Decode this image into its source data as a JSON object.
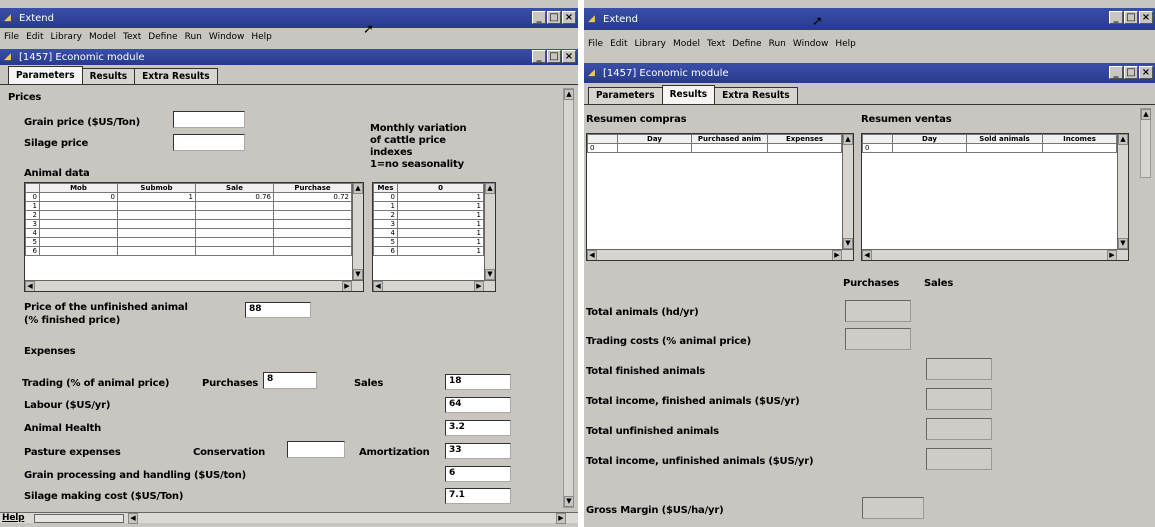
{
  "left": {
    "app_title": "Extend",
    "menu": [
      "File",
      "Edit",
      "Library",
      "Model",
      "Text",
      "Define",
      "Run",
      "Window",
      "Help"
    ],
    "doc_title": "[1457]  Economic module",
    "tabs": [
      "Parameters",
      "Results",
      "Extra Results"
    ],
    "prices_heading": "Prices",
    "grain_price_label": "Grain price ($US/Ton)",
    "silage_price_label": "Silage price",
    "monthly_variation_label": [
      "Monthly variation",
      "of cattle price",
      "indexes",
      "1=no seasonality"
    ],
    "animal_data_label": "Animal data",
    "animal_table": {
      "headers": [
        "",
        "Mob",
        "Submob",
        "Sale",
        "Purchase"
      ],
      "rows": [
        [
          "0",
          "0",
          "1",
          "0.76",
          "0.72"
        ],
        [
          "1",
          "",
          "",
          "",
          ""
        ],
        [
          "2",
          "",
          "",
          "",
          ""
        ],
        [
          "3",
          "",
          "",
          "",
          ""
        ],
        [
          "4",
          "",
          "",
          "",
          ""
        ],
        [
          "5",
          "",
          "",
          "",
          ""
        ],
        [
          "6",
          "",
          "",
          "",
          ""
        ]
      ]
    },
    "month_table": {
      "headers": [
        "Mes",
        "0"
      ],
      "rows": [
        [
          "0",
          "1"
        ],
        [
          "1",
          "1"
        ],
        [
          "2",
          "1"
        ],
        [
          "3",
          "1"
        ],
        [
          "4",
          "1"
        ],
        [
          "5",
          "1"
        ],
        [
          "6",
          "1"
        ]
      ]
    },
    "unfinished_label": [
      "Price of the unfinished animal",
      "(% finished price)"
    ],
    "unfinished_value": "88",
    "expenses_heading": "Expenses",
    "trading_label": "Trading (% of animal price)",
    "purchases_label": "Purchases",
    "purchases_value": "8",
    "sales_label": "Sales",
    "sales_value": "18",
    "labour_label": "Labour ($US/yr)",
    "labour_value": "64",
    "animal_health_label": "Animal Health",
    "animal_health_value": "3.2",
    "pasture_label": "Pasture expenses",
    "conservation_label": "Conservation",
    "amortization_label": "Amortization",
    "amortization_value": "33",
    "grain_processing_label": "Grain processing and handling ($US/ton)",
    "grain_processing_value": "6",
    "silage_making_label": "Silage making cost ($US/Ton)",
    "silage_making_value": "7.1",
    "help_label": "Help"
  },
  "right": {
    "app_title": "Extend",
    "menu": [
      "File",
      "Edit",
      "Library",
      "Model",
      "Text",
      "Define",
      "Run",
      "Window",
      "Help"
    ],
    "doc_title": "[1457]  Economic module",
    "tabs": [
      "Parameters",
      "Results",
      "Extra Results"
    ],
    "compras_heading": "Resumen compras",
    "compras_headers": [
      "",
      "Day",
      "Purchased anim",
      "Expenses"
    ],
    "compras_row0": "0",
    "ventas_heading": "Resumen ventas",
    "ventas_headers": [
      "",
      "Day",
      "Sold animals",
      "Incomes"
    ],
    "ventas_row0": "0",
    "purchases_col": "Purchases",
    "sales_col": "Sales",
    "total_animals_label": "Total animals (hd/yr)",
    "trading_costs_label": "Trading costs (% animal price)",
    "total_finished_label": "Total finished animals",
    "income_finished_label": "Total income, finished animals ($US/yr)",
    "total_unfinished_label": "Total unfinished animals",
    "income_unfinished_label": "Total income, unfinished animals ($US/yr)",
    "gross_margin_label": "Gross Margin ($US/ha/yr)"
  },
  "colors": {
    "titlebar": "#2f4399",
    "panel": "#c9c6c2"
  }
}
